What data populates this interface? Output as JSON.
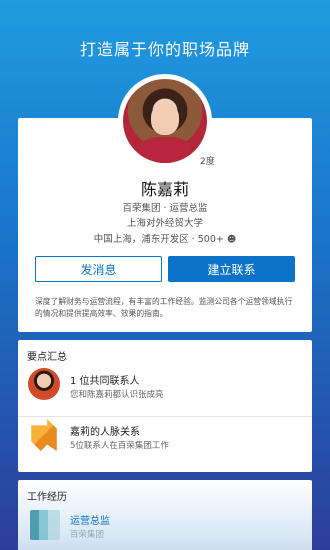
{
  "header": {
    "slogan": "打造属于你的职场品牌"
  },
  "profile": {
    "degree": "2度",
    "name": "陈嘉莉",
    "headline": "百荣集团 · 运营总监",
    "school": "上海对外经贸大学",
    "location_connections": "中国上海，浦东开发区 · 500+",
    "connections_icon": "people-icon",
    "message_button": "发消息",
    "connect_button": "建立联系",
    "bio": "深度了解财务与运营流程，有丰富的工作经验。监测公司各个运营领域执行的情况和提供提高效率、效果的指南。"
  },
  "highlights": {
    "title": "要点汇总",
    "items": [
      {
        "title": "1 位共同联系人",
        "subtitle": "您和陈嘉莉都认识张成亮",
        "icon": "person-avatar"
      },
      {
        "title": "嘉莉的人脉关系",
        "subtitle": "5位联系人在百荣集团工作",
        "icon": "ribbon-icon"
      }
    ]
  },
  "experience": {
    "title": "工作经历",
    "role": "运营总监",
    "subtitle": "百荣集团"
  },
  "colors": {
    "primary": "#0b74c8",
    "background_top": "#1f9be0",
    "background_bottom": "#2c3e9a"
  }
}
